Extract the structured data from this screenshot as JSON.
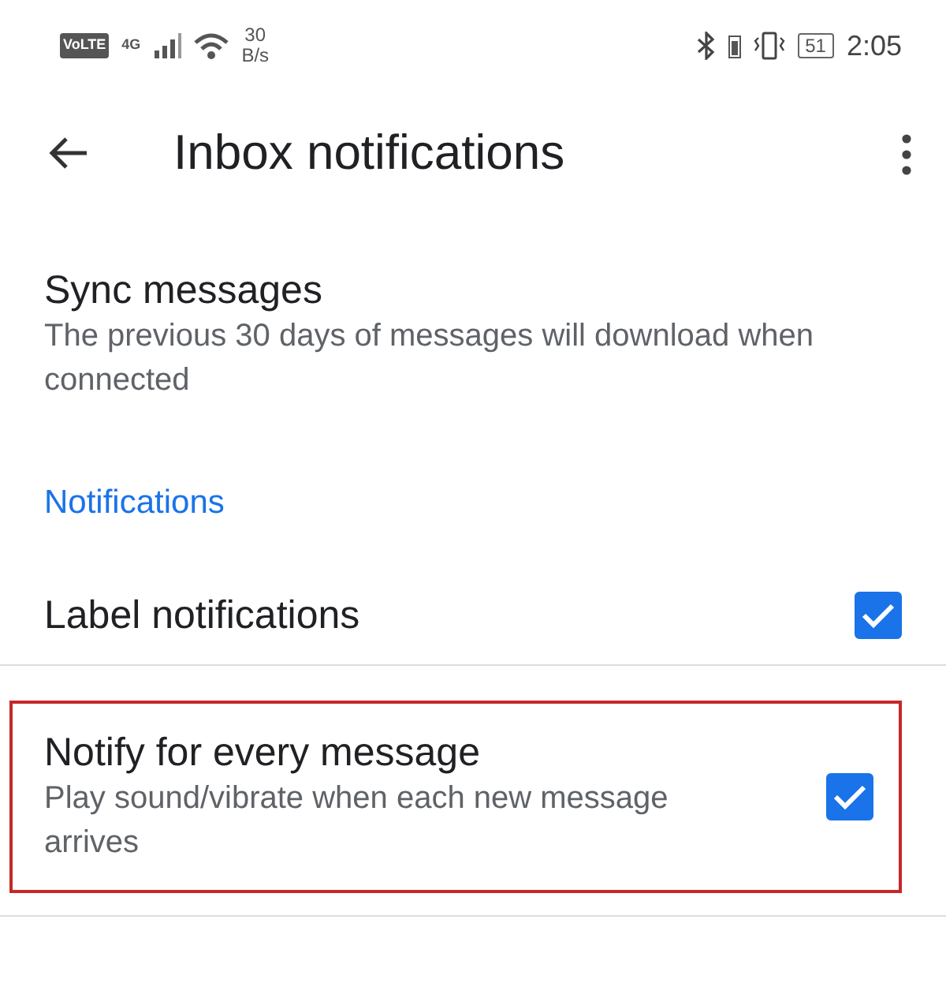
{
  "status_bar": {
    "volte": "VoLTE",
    "network": "4G",
    "speed_value": "30",
    "speed_unit": "B/s",
    "battery": "51",
    "time": "2:05"
  },
  "app_bar": {
    "title": "Inbox notifications"
  },
  "items": [
    {
      "kind": "text",
      "title": "Sync messages",
      "subtitle": "The previous 30 days of messages will download when connected",
      "highlighted": false
    },
    {
      "kind": "header",
      "title": "Notifications"
    },
    {
      "kind": "checkbox",
      "title": "Label notifications",
      "checked": true,
      "highlighted": false
    },
    {
      "kind": "checkbox",
      "title": "Notify for every message",
      "subtitle": "Play sound/vibrate when each new message arrives",
      "checked": true,
      "highlighted": true
    }
  ]
}
